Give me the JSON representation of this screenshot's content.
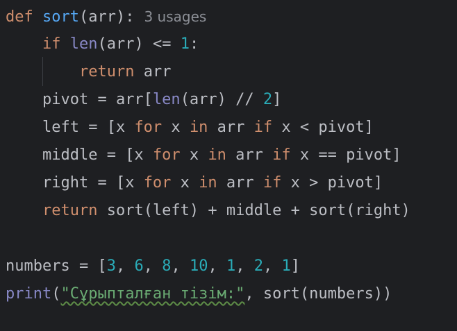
{
  "code": {
    "line1": {
      "kw_def": "def",
      "fn_name": "sort",
      "params": "(arr):",
      "usages_hint": "3 usages"
    },
    "line2": {
      "indent": "    ",
      "kw_if": "if",
      "space": " ",
      "builtin_len": "len",
      "rest": "(arr) <= ",
      "num": "1",
      "colon": ":"
    },
    "line3": {
      "indent": "        ",
      "kw_return": "return",
      "rest": " arr"
    },
    "line4": {
      "indent": "    ",
      "pre": "pivot = arr[",
      "builtin_len": "len",
      "mid": "(arr) // ",
      "num": "2",
      "close": "]"
    },
    "line5": {
      "indent": "    ",
      "a": "left = [x ",
      "kw_for": "for",
      "b": " x ",
      "kw_in": "in",
      "c": " arr ",
      "kw_if": "if",
      "d": " x < pivot]"
    },
    "line6": {
      "indent": "    ",
      "a": "middle = [x ",
      "kw_for": "for",
      "b": " x ",
      "kw_in": "in",
      "c": " arr ",
      "kw_if": "if",
      "d": " x == pivot]"
    },
    "line7": {
      "indent": "    ",
      "a": "right = [x ",
      "kw_for": "for",
      "b": " x ",
      "kw_in": "in",
      "c": " arr ",
      "kw_if": "if",
      "d": " x > pivot]"
    },
    "line8": {
      "indent": "    ",
      "kw_return": "return",
      "rest": " sort(left) + middle + sort(right)"
    },
    "line10": {
      "pre": "numbers = [",
      "n1": "3",
      "s1": ", ",
      "n2": "6",
      "s2": ", ",
      "n3": "8",
      "s3": ", ",
      "n4": "10",
      "s4": ", ",
      "n5": "1",
      "s5": ", ",
      "n6": "2",
      "s6": ", ",
      "n7": "1",
      "close": "]"
    },
    "line11": {
      "builtin_print": "print",
      "open": "(",
      "string": "\"Сұрыпталған тізім:\"",
      "rest": ", sort(numbers))"
    }
  },
  "colors": {
    "background": "#1e1f22",
    "keyword": "#cf8e6d",
    "function": "#56a8f5",
    "builtin": "#8888c6",
    "number": "#2aacb8",
    "string": "#6aab73",
    "text": "#bcbec4",
    "hint": "#8c8f96"
  }
}
